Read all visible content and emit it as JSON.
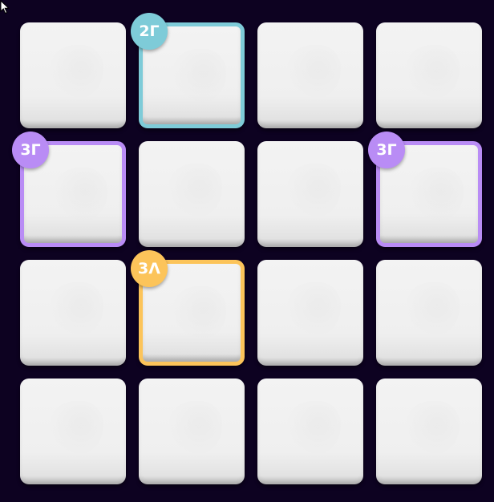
{
  "colors": {
    "background": "#0d0221",
    "tile": "#efefef",
    "teal": "#7ecbd8",
    "purple": "#b98cf5",
    "orange": "#fcc45a"
  },
  "board": {
    "rows": 4,
    "cols": 4,
    "tiles": [
      {
        "row": 0,
        "col": 0,
        "badge": null
      },
      {
        "row": 0,
        "col": 1,
        "badge": "2Г",
        "color": "#7ecbd8"
      },
      {
        "row": 0,
        "col": 2,
        "badge": null
      },
      {
        "row": 0,
        "col": 3,
        "badge": null
      },
      {
        "row": 1,
        "col": 0,
        "badge": "3Г",
        "color": "#b98cf5"
      },
      {
        "row": 1,
        "col": 1,
        "badge": null
      },
      {
        "row": 1,
        "col": 2,
        "badge": null
      },
      {
        "row": 1,
        "col": 3,
        "badge": "3Г",
        "color": "#b98cf5"
      },
      {
        "row": 2,
        "col": 0,
        "badge": null
      },
      {
        "row": 2,
        "col": 1,
        "badge": "3Λ",
        "color": "#fcc45a"
      },
      {
        "row": 2,
        "col": 2,
        "badge": null
      },
      {
        "row": 2,
        "col": 3,
        "badge": null
      },
      {
        "row": 3,
        "col": 0,
        "badge": null
      },
      {
        "row": 3,
        "col": 1,
        "badge": null
      },
      {
        "row": 3,
        "col": 2,
        "badge": null
      },
      {
        "row": 3,
        "col": 3,
        "badge": null
      }
    ]
  },
  "cursor": {
    "icon": "mouse-pointer-icon"
  }
}
